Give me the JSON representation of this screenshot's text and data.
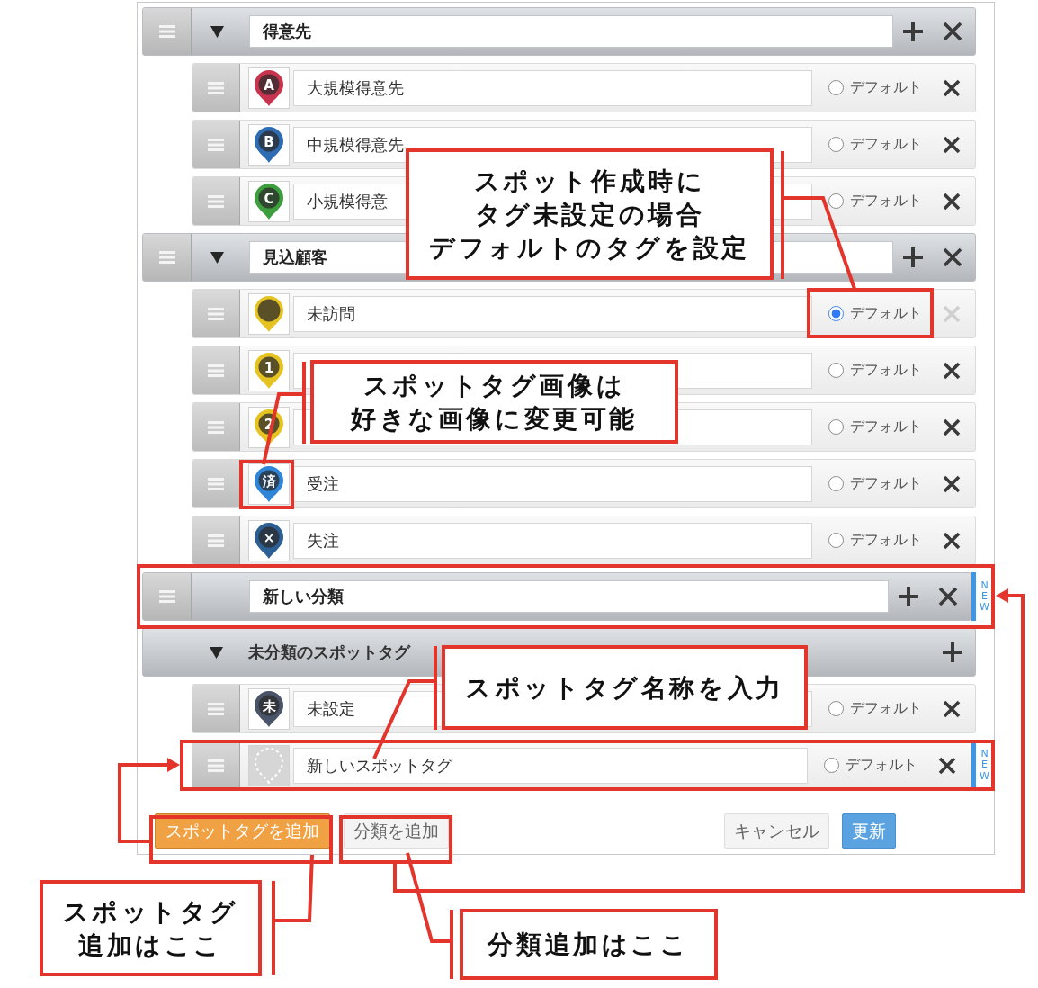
{
  "categories": [
    {
      "name": "得意先",
      "expanded": true,
      "tags": [
        {
          "name": "大規模得意先",
          "icon": {
            "kind": "pin",
            "glyph": "A",
            "color": "#c8344d"
          },
          "default_option": {
            "label": "デフォルト",
            "selected": false
          }
        },
        {
          "name": "中規模得意先",
          "icon": {
            "kind": "pin",
            "glyph": "B",
            "color": "#2e6db4"
          },
          "default_option": {
            "label": "デフォルト",
            "selected": false
          }
        },
        {
          "name": "小規模得意",
          "icon": {
            "kind": "pin",
            "glyph": "C",
            "color": "#3d9e3d"
          },
          "default_option": {
            "label": "デフォルト",
            "selected": false
          }
        }
      ]
    },
    {
      "name": "見込顧客",
      "expanded": true,
      "tags": [
        {
          "name": "未訪問",
          "icon": {
            "kind": "pin",
            "color": "#e6c321"
          },
          "default_option": {
            "label": "デフォルト",
            "selected": true
          }
        },
        {
          "icon": {
            "kind": "pin",
            "glyph": "1",
            "color": "#e6c321"
          },
          "default_option": {
            "label": "デフォルト",
            "selected": false
          }
        },
        {
          "icon": {
            "kind": "pin",
            "glyph": "2",
            "color": "#e6c321"
          },
          "default_option": {
            "label": "デフォルト",
            "selected": false
          }
        },
        {
          "name": "受注",
          "icon": {
            "kind": "pin",
            "glyph": "済",
            "color": "#2f86d8"
          },
          "default_option": {
            "label": "デフォルト",
            "selected": false
          }
        },
        {
          "name": "失注",
          "icon": {
            "kind": "pin",
            "glyph": "×",
            "color": "#2c5f93"
          },
          "default_option": {
            "label": "デフォルト",
            "selected": false
          }
        }
      ]
    },
    {
      "name": "新しい分類",
      "badge": "NEW"
    }
  ],
  "uncategorized": {
    "title": "未分類のスポットタグ",
    "expanded": true,
    "tags": [
      {
        "name": "未設定",
        "icon": {
          "kind": "pin",
          "glyph": "未",
          "color": "#4a5468"
        },
        "default_option": {
          "label": "デフォルト",
          "selected": false
        }
      },
      {
        "name": "新しいスポットタグ",
        "icon": {
          "kind": "placeholder"
        },
        "default_option": {
          "label": "デフォルト",
          "selected": false
        },
        "badge": "NEW"
      }
    ]
  },
  "footer": {
    "left_buttons": [
      {
        "label": "スポットタグを追加",
        "kind": "accent"
      },
      {
        "label": "分類を追加",
        "kind": "plain"
      }
    ],
    "right_buttons": [
      {
        "label": "キャンセル",
        "kind": "plain"
      },
      {
        "label": "更新",
        "kind": "primary"
      }
    ]
  },
  "annotations": [
    {
      "lines": [
        "スポット作成時に",
        "タグ未設定の場合",
        "デフォルトのタグを設定"
      ]
    },
    {
      "lines": [
        "スポットタグ画像は",
        "好きな画像に変更可能"
      ]
    },
    {
      "lines": [
        "スポットタグ名称を入力"
      ]
    },
    {
      "lines": [
        "スポットタグ",
        "追加はここ"
      ]
    },
    {
      "lines": [
        "分類追加はここ"
      ]
    }
  ]
}
